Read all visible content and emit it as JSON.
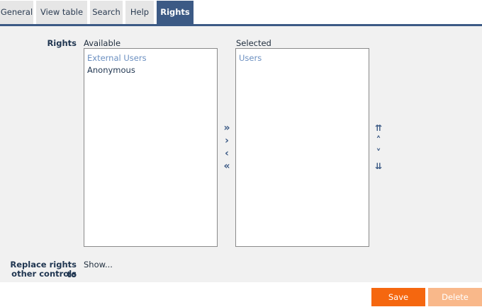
{
  "tabs": [
    {
      "label": "General"
    },
    {
      "label": "View table"
    },
    {
      "label": "Search"
    },
    {
      "label": "Help"
    },
    {
      "label": "Rights"
    }
  ],
  "rights": {
    "label": "Rights",
    "available_caption": "Available",
    "selected_caption": "Selected",
    "available_items": [
      "External Users",
      "Anonymous"
    ],
    "selected_items": [
      "Users"
    ]
  },
  "transfer_buttons": {
    "add_all": "»",
    "add": "›",
    "remove": "‹",
    "remove_all": "«"
  },
  "order_buttons": {
    "top": "⇈",
    "up": "˄",
    "down": "˅",
    "bottom": "⇊"
  },
  "replace": {
    "label_line1": "Replace rights to",
    "label_line2": "other controls",
    "link": "Show..."
  },
  "footer": {
    "save_label": "Save",
    "delete_label": "Delete"
  },
  "colors": {
    "accent": "#3c5a85",
    "save": "#f5670f",
    "delete_disabled": "#f9b88a"
  }
}
